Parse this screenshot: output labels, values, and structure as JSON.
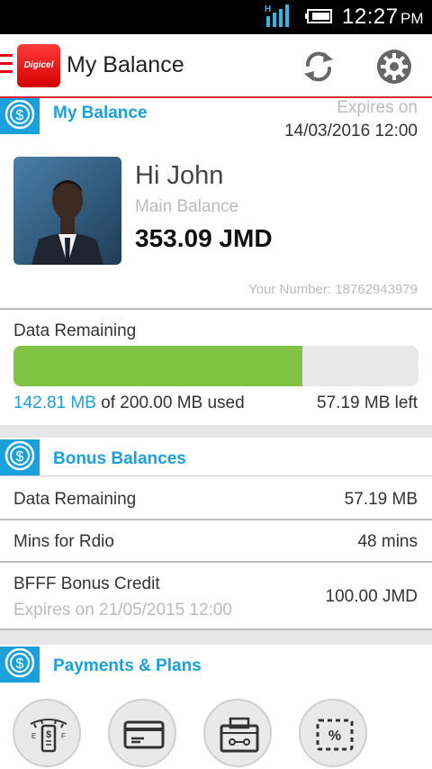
{
  "status_bar": {
    "network_type": "H",
    "time": "12:27",
    "ampm": "PM"
  },
  "app_bar": {
    "logo_text": "Digicel",
    "title": "My Balance"
  },
  "my_balance": {
    "section_title": "My Balance",
    "expires_label": "Expires on",
    "expires_date": "14/03/2016 12:00",
    "greeting": "Hi John",
    "main_balance_label": "Main Balance",
    "main_balance_value": "353.09 JMD",
    "your_number": "Your Number: 18762943979"
  },
  "data_remaining": {
    "label": "Data Remaining",
    "used_fraction": 0.714,
    "used_amount": "142.81 MB",
    "used_suffix": " of 200.00 MB used",
    "left_text": "57.19 MB left",
    "fill_color": "#80c342"
  },
  "bonus_balances": {
    "section_title": "Bonus Balances",
    "rows": [
      {
        "label": "Data Remaining",
        "value": "57.19 MB"
      },
      {
        "label": "Mins for Rdio",
        "value": "48 mins"
      },
      {
        "label": "BFFF Bonus Credit",
        "value": "100.00 JMD",
        "sub": "Expires on 21/05/2015 12:00"
      }
    ]
  },
  "payments_plans": {
    "section_title": "Payments & Plans",
    "buttons": [
      "top-up-meter-icon",
      "credit-card-icon",
      "voucher-machine-icon",
      "discount-coupon-icon"
    ]
  },
  "colors": {
    "accent_blue": "#1ba0de",
    "brand_red": "#e30613",
    "progress_green": "#80c342"
  }
}
